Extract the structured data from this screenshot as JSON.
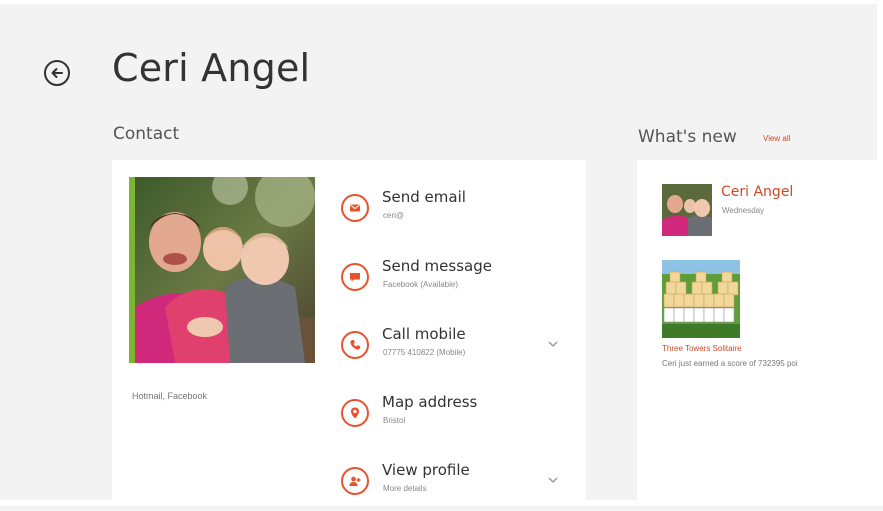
{
  "header": {
    "title": "Ceri Angel",
    "back_icon": "back-arrow-icon"
  },
  "contact": {
    "section_label": "Contact",
    "photo_sources": "Hotmail, Facebook",
    "accent_color": "#e8532e",
    "photo_bar_color": "#7db533",
    "actions": [
      {
        "label": "Send email",
        "sub": "ceri@",
        "icon": "mail-icon"
      },
      {
        "label": "Send message",
        "sub": "Facebook (Available)",
        "icon": "chat-icon"
      },
      {
        "label": "Call mobile",
        "sub": "07775 410822 (Mobile)",
        "icon": "phone-icon",
        "expandable": true
      },
      {
        "label": "Map address",
        "sub": "Bristol",
        "icon": "map-pin-icon"
      },
      {
        "label": "View profile",
        "sub": "More details",
        "icon": "profile-icon",
        "expandable": true
      }
    ]
  },
  "whats_new": {
    "section_label": "What's new",
    "view_all": "View all",
    "items": [
      {
        "name": "Ceri Angel",
        "day": "Wednesday"
      },
      {
        "game": "Three Towers Solitaire",
        "description": "Ceri just earned a score of 732395 poi"
      }
    ],
    "accent_color": "#d24726"
  }
}
